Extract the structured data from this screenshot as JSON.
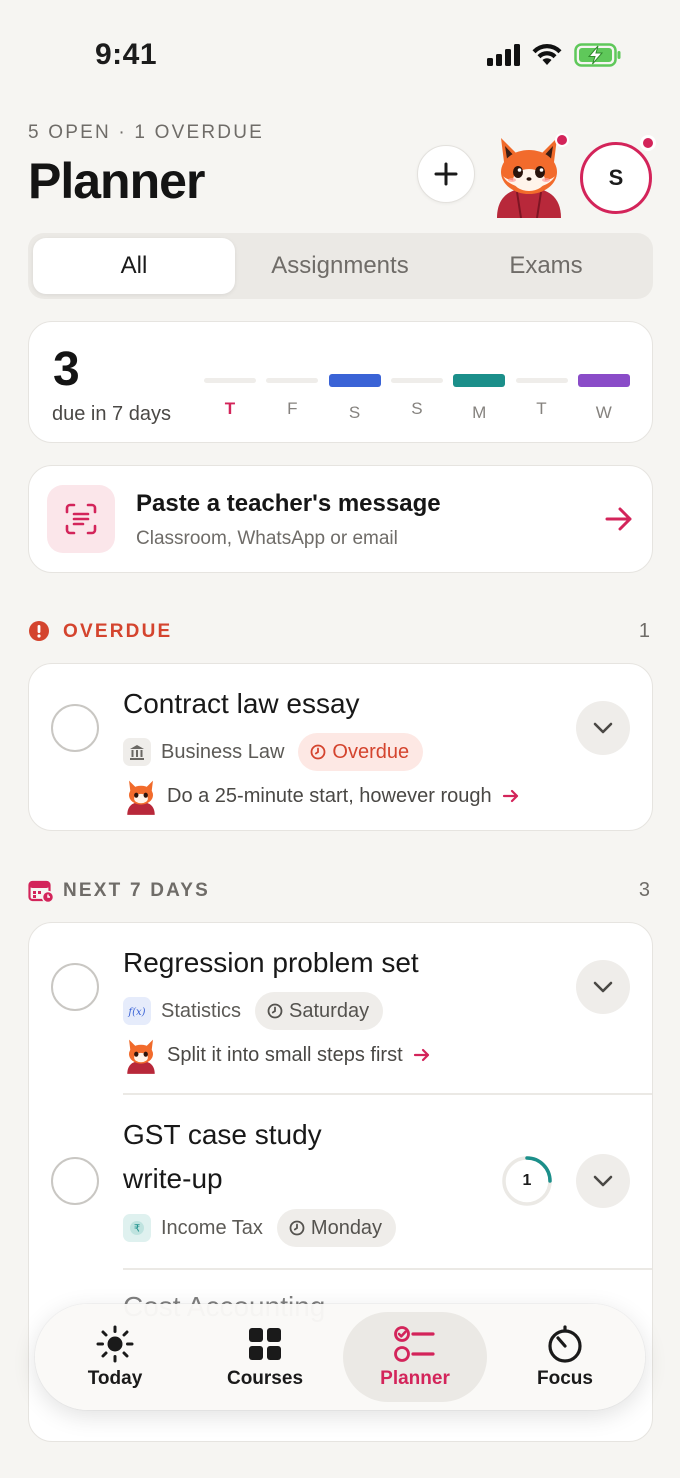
{
  "status_bar": {
    "time": "9:41"
  },
  "header": {
    "meta": "5 OPEN · 1 OVERDUE",
    "title": "Planner"
  },
  "avatar": {
    "initial": "S"
  },
  "tabs": [
    {
      "label": "All",
      "active": true
    },
    {
      "label": "Assignments",
      "active": false
    },
    {
      "label": "Exams",
      "active": false
    }
  ],
  "week_summary": {
    "count": "3",
    "label": "due in 7 days",
    "days": [
      {
        "letter": "T",
        "today": true,
        "color": null
      },
      {
        "letter": "F",
        "today": false,
        "color": null
      },
      {
        "letter": "S",
        "today": false,
        "color": "#3a63d6"
      },
      {
        "letter": "S",
        "today": false,
        "color": null
      },
      {
        "letter": "M",
        "today": false,
        "color": "#1b8f8a"
      },
      {
        "letter": "T",
        "today": false,
        "color": null
      },
      {
        "letter": "W",
        "today": false,
        "color": "#8a4cc8"
      }
    ]
  },
  "paste_card": {
    "title": "Paste a teacher's message",
    "subtitle": "Classroom, WhatsApp or email"
  },
  "overdue_section": {
    "label": "OVERDUE",
    "count": "1",
    "color": "#d4442e"
  },
  "next_section": {
    "label": "NEXT 7 DAYS",
    "count": "3",
    "color": "#6f6c68"
  },
  "tasks": {
    "overdue": [
      {
        "title": "Contract law essay",
        "course": "Business Law",
        "course_icon": "bank-icon",
        "chip": "Overdue",
        "hint": "Do a 25-minute start, however rough"
      }
    ],
    "upcoming": [
      {
        "title": "Regression problem set",
        "course": "Statistics",
        "course_icon": "function-icon",
        "chip": "Saturday",
        "hint": "Split it into small steps first"
      },
      {
        "title_line1": "GST case study",
        "title_line2": "write-up",
        "course": "Income Tax",
        "course_icon": "rupee-icon",
        "chip": "Monday",
        "progress_label": "1",
        "progress": 0.25
      },
      {
        "title": "Cost Accounting"
      }
    ]
  },
  "tab_bar": [
    {
      "label": "Today",
      "icon": "sun-icon",
      "active": false
    },
    {
      "label": "Courses",
      "icon": "grid-icon",
      "active": false
    },
    {
      "label": "Planner",
      "icon": "checklist-icon",
      "active": true
    },
    {
      "label": "Focus",
      "icon": "timer-icon",
      "active": false
    }
  ],
  "colors": {
    "accent": "#d3245a",
    "overdue": "#d4442e",
    "background": "#f6f5f2"
  }
}
